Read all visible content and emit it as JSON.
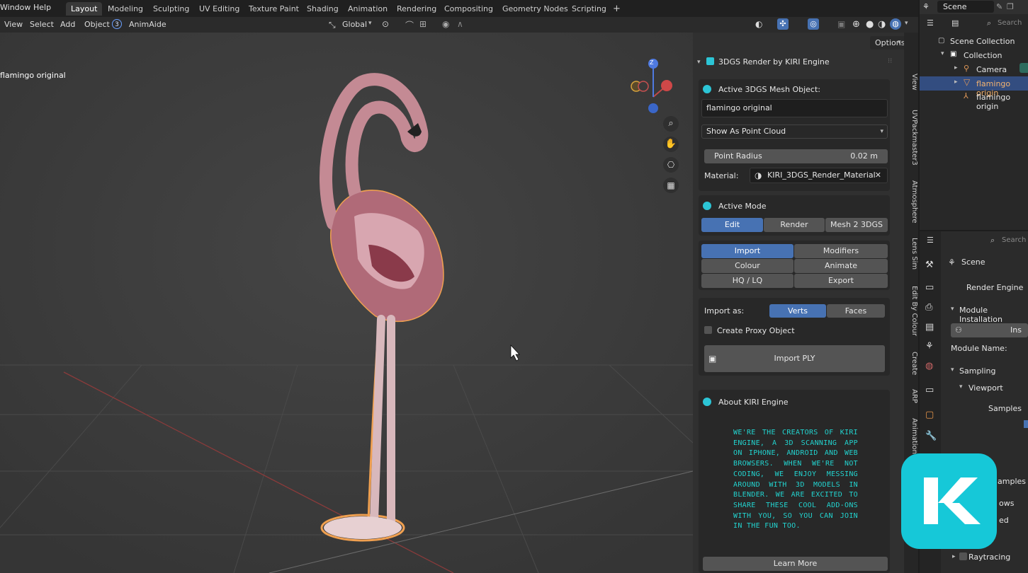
{
  "menu": [
    "Window",
    "Help"
  ],
  "workspaces": [
    "Layout",
    "Modeling",
    "Sculpting",
    "UV Editing",
    "Texture Paint",
    "Shading",
    "Animation",
    "Rendering",
    "Compositing",
    "Geometry Nodes",
    "Scripting"
  ],
  "active_workspace": "Layout",
  "add_tab": "+",
  "header": {
    "items": [
      "View",
      "Select",
      "Add",
      "Object"
    ],
    "animaide_badge": "3",
    "animaide": "AnimAide",
    "orientation": "Global",
    "options": "Options"
  },
  "viewport": {
    "object_label": "flamingo original",
    "gizmo_z": "Z"
  },
  "kiri_panel": {
    "title": "3DGS Render by KIRI Engine",
    "active_mesh_label": "Active 3DGS Mesh Object:",
    "active_mesh_value": "flamingo original",
    "display_mode": "Show As Point Cloud",
    "point_radius_label": "Point Radius",
    "point_radius_value": "0.02 m",
    "material_label": "Material:",
    "material_value": "KIRI_3DGS_Render_Material",
    "active_mode_label": "Active Mode",
    "modes": [
      "Edit",
      "Render",
      "Mesh 2 3DGS"
    ],
    "tools": [
      "Import",
      "Modifiers",
      "Colour",
      "Animate",
      "HQ / LQ",
      "Export"
    ],
    "import_as_label": "Import as:",
    "import_as_options": [
      "Verts",
      "Faces"
    ],
    "create_proxy_label": "Create Proxy Object",
    "import_button": "Import PLY",
    "about_title": "About KIRI Engine",
    "about_text": "WE'RE THE CREATORS OF KIRI ENGINE, A 3D SCANNING APP ON IPHONE, ANDROID AND WEB BROWSERS. WHEN WE'RE NOT CODING, WE ENJOY MESSING AROUND WITH 3D MODELS IN BLENDER. WE ARE EXCITED TO SHARE THESE COOL ADD-ONS WITH YOU, SO YOU CAN JOIN IN THE FUN TOO.",
    "learn_more": "Learn More"
  },
  "side_tabs": [
    "View",
    "UVPackmaster3",
    "Atmosphere",
    "Lens Sim",
    "Edit By Colour",
    "Create",
    "ARP",
    "Animation"
  ],
  "outliner": {
    "scene_label": "Scene",
    "search_placeholder": "Search",
    "items": [
      "Scene Collection",
      "Collection",
      "Camera",
      "flamingo origin",
      "flamingo origin"
    ]
  },
  "properties": {
    "search_placeholder": "Search",
    "scene_label": "Scene",
    "render_engine_label": "Render Engine",
    "module_installation": "Module Installation",
    "install_stub": "Ins",
    "module_name_label": "Module Name:",
    "sampling": "Sampling",
    "viewport": "Viewport",
    "samples": "Samples",
    "samples2": "amples",
    "ows": "ows",
    "ed": "ed",
    "raytracing": "Raytracing"
  },
  "colors": {
    "accent_blue": "#4772b3",
    "kiri_cyan": "#2cc5d6",
    "about_text": "#22d3cf",
    "logo_bg": "#16c8d8"
  }
}
